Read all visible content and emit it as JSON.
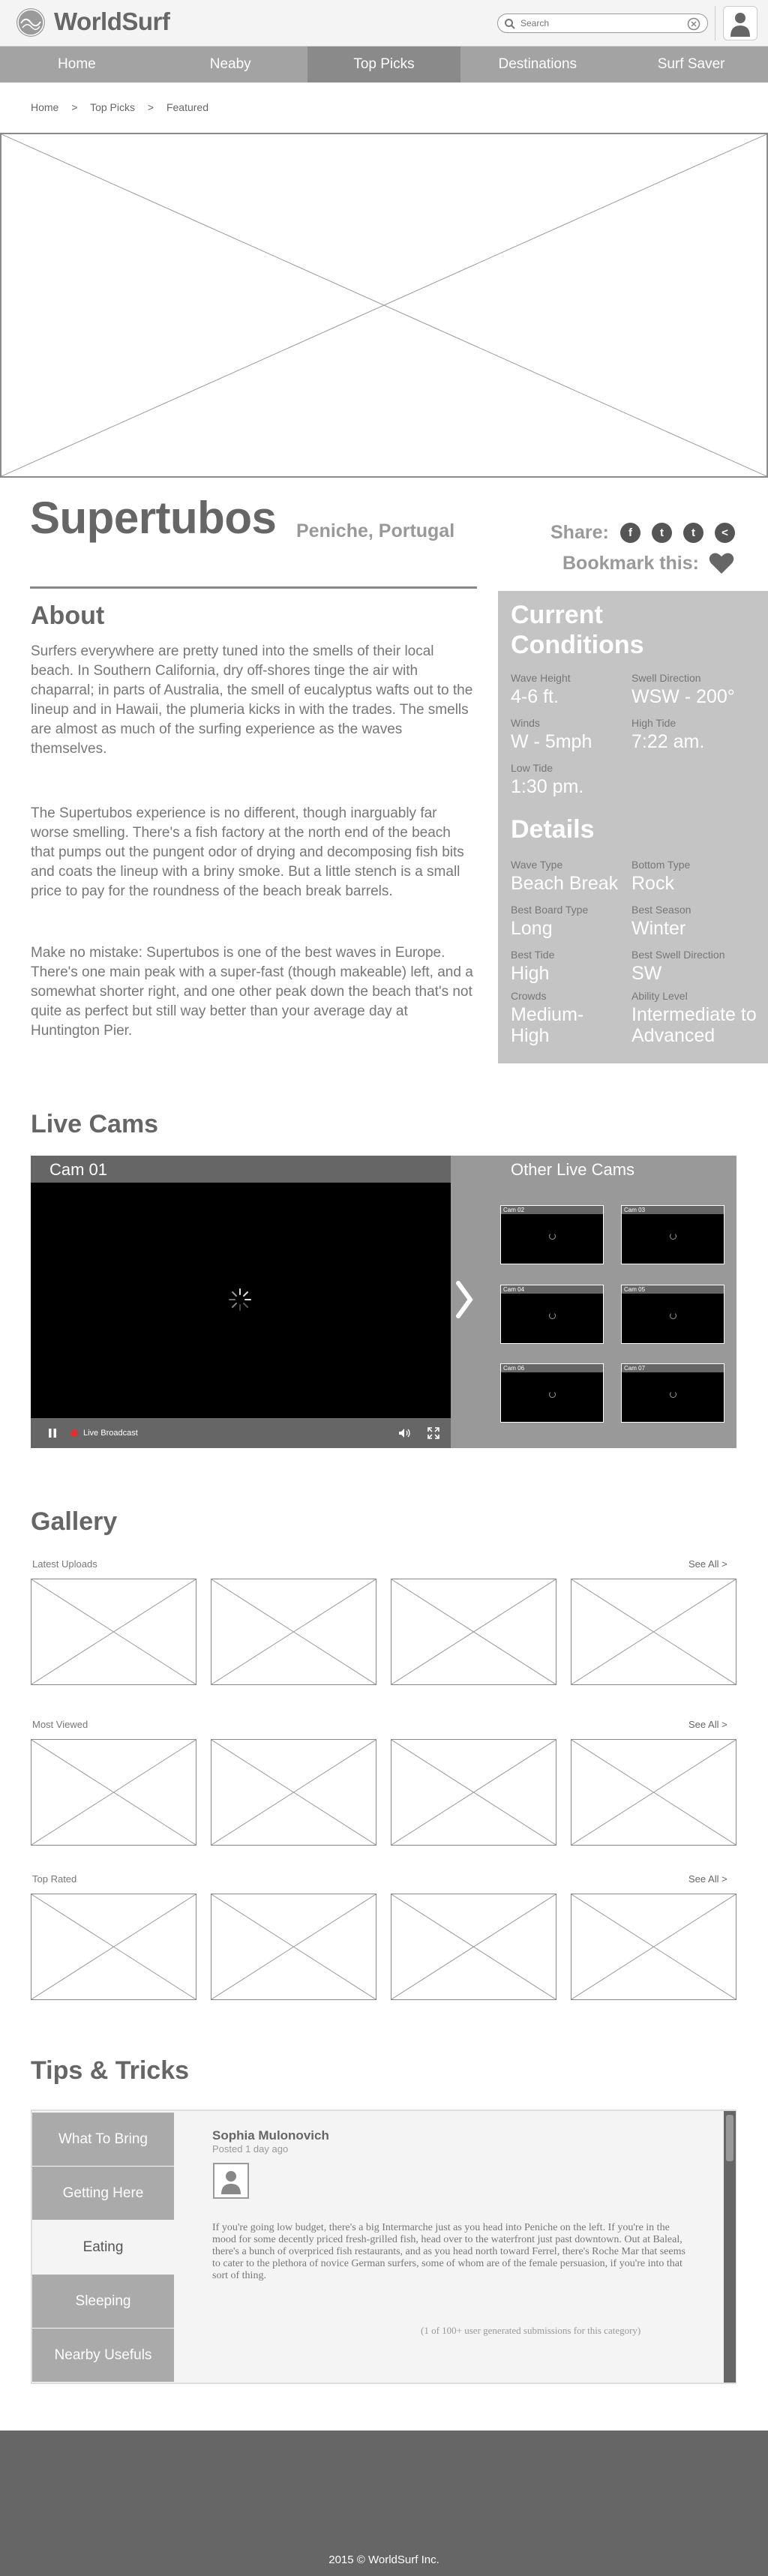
{
  "header": {
    "brand": "WorldSurf",
    "search_placeholder": "Search"
  },
  "nav": [
    {
      "label": "Home"
    },
    {
      "label": "Neaby"
    },
    {
      "label": "Top Picks",
      "active": true
    },
    {
      "label": "Destinations"
    },
    {
      "label": "Surf Saver"
    }
  ],
  "breadcrumb": [
    "Home",
    ">",
    "Top Picks",
    ">",
    "Featured"
  ],
  "spot": {
    "name": "Supertubos",
    "location": "Peniche, Portugal",
    "share_label": "Share:",
    "share_icons": [
      "f",
      "t",
      "t",
      "<"
    ],
    "bookmark_label": "Bookmark this:"
  },
  "about": {
    "title": "About",
    "paragraphs": [
      "Surfers everywhere are pretty tuned into the smells of their local beach. In Southern California, dry off-shores tinge the air with chaparral; in parts of Australia, the smell of eucalyptus wafts out to the lineup and in Hawaii, the plumeria kicks in with the trades. The smells are almost as much of the surfing experience as the waves themselves.",
      "The Supertubos experience is no different, though inarguably far worse smelling. There's a fish factory at the north end of the beach that pumps out the pungent odor of drying and decomposing fish bits and coats the lineup with a briny smoke. But a little stench is a small price to pay for the roundness of the beach break barrels.",
      "Make no mistake: Supertubos is one of the best waves in Europe. There's one main peak with a super-fast (though makeable) left, and a somewhat shorter right, and one other peak down the beach that's not quite as perfect but still way better than your average day at Huntington Pier."
    ]
  },
  "conditions": {
    "title": "Current Conditions",
    "wave_height_label": "Wave Height",
    "wave_height": "4-6 ft.",
    "swell_dir_label": "Swell Direction",
    "swell_dir": "WSW - 200°",
    "winds_label": "Winds",
    "winds": "W - 5mph",
    "high_tide_label": "High Tide",
    "high_tide": "7:22 am.",
    "low_tide_label": "Low Tide",
    "low_tide": "1:30 pm."
  },
  "details": {
    "title": "Details",
    "wave_type_label": "Wave Type",
    "wave_type": "Beach Break",
    "bottom_type_label": "Bottom Type",
    "bottom_type": "Rock",
    "board_label": "Best Board Type",
    "board": "Long",
    "season_label": "Best Season",
    "season": "Winter",
    "tide_label": "Best Tide",
    "tide": "High",
    "swell_label": "Best Swell Direction",
    "swell": "SW",
    "crowds_label": "Crowds",
    "crowds": "Medium-High",
    "ability_label": "Ability Level",
    "ability": "Intermediate to Advanced"
  },
  "livecams": {
    "title": "Live Cams",
    "main_cam": "Cam 01",
    "live_label": "Live Broadcast",
    "other_title": "Other Live Cams",
    "thumbs": [
      "Cam 02",
      "Cam 03",
      "Cam 04",
      "Cam 05",
      "Cam 06",
      "Cam 07"
    ]
  },
  "gallery": {
    "title": "Gallery",
    "see_all": "See All  >",
    "sections": [
      "Latest Uploads",
      "Most Viewed",
      "Top Rated"
    ]
  },
  "tips": {
    "title": "Tips & Tricks",
    "tabs": [
      "What To Bring",
      "Getting Here",
      "Eating",
      "Sleeping",
      "Nearby Usefuls"
    ],
    "active_tab": "Eating",
    "author": "Sophia Mulonovich",
    "posted": "Posted 1 day ago",
    "body": "If you're going low budget, there's a big Intermarche just as you head into Peniche on the left. If you're in the mood for some decently priced fresh-grilled fish, head over to the waterfront just past downtown. Out at Baleal, there's a bunch of overpriced fish restaurants, and as you head north toward Ferrel, there's Roche Mar that seems to cater to the plethora of novice German surfers, some of whom are of the female persuasion, if you're into that sort of thing.",
    "count": "(1 of 100+ user generated submissions for this category)"
  },
  "footer": {
    "copyright": "2015 © WorldSurf Inc."
  }
}
